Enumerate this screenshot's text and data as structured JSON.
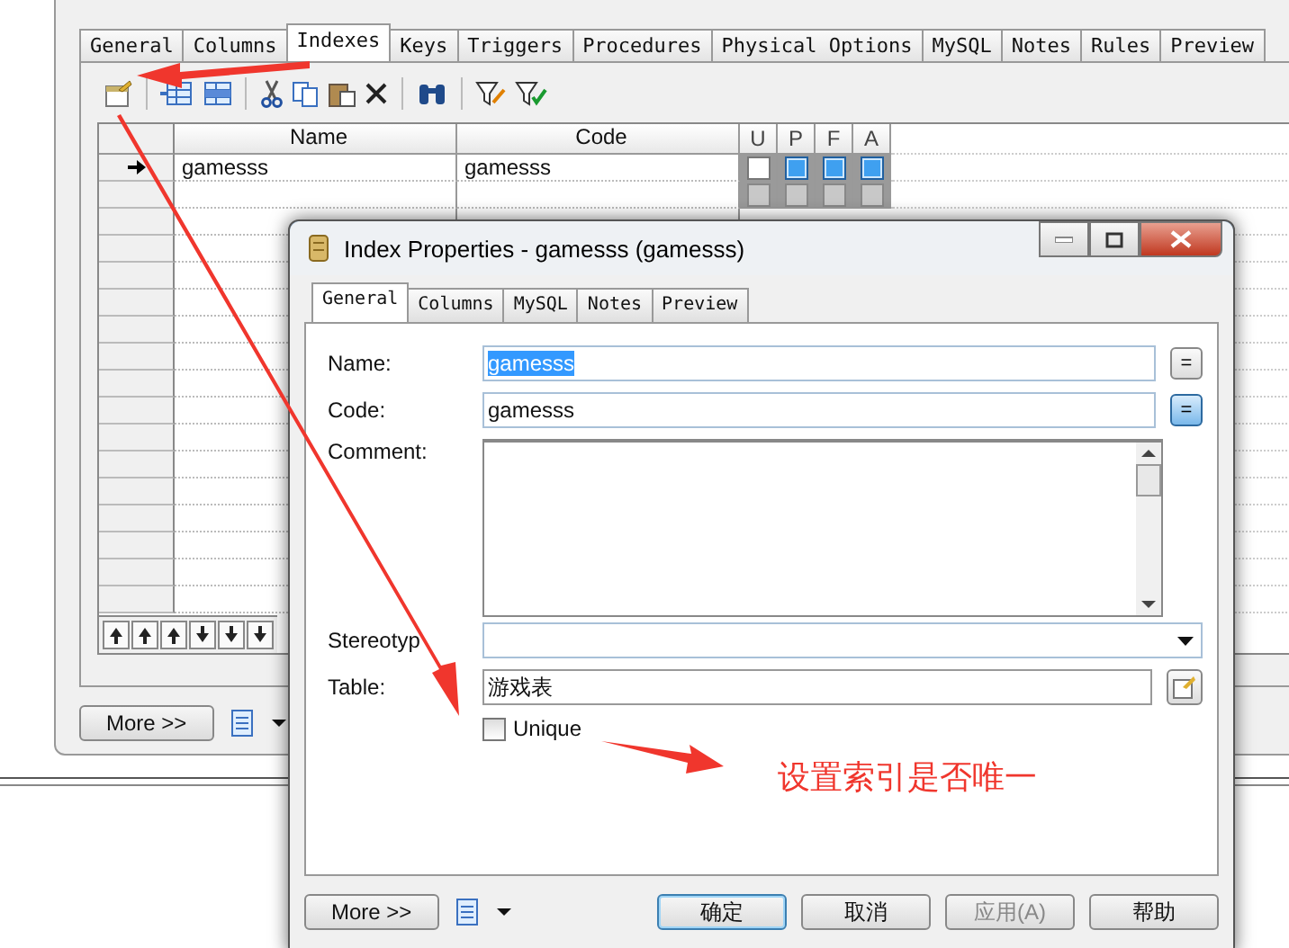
{
  "main_window": {
    "tabs": [
      {
        "label": "General",
        "selected": false
      },
      {
        "label": "Columns",
        "selected": false
      },
      {
        "label": "Indexes",
        "selected": true
      },
      {
        "label": "Keys",
        "selected": false
      },
      {
        "label": "Triggers",
        "selected": false
      },
      {
        "label": "Procedures",
        "selected": false
      },
      {
        "label": "Physical Options",
        "selected": false
      },
      {
        "label": "MySQL",
        "selected": false
      },
      {
        "label": "Notes",
        "selected": false
      },
      {
        "label": "Rules",
        "selected": false
      },
      {
        "label": "Preview",
        "selected": false
      }
    ],
    "grid": {
      "columns": [
        "Name",
        "Code"
      ],
      "flag_columns": [
        "U",
        "P",
        "F",
        "A"
      ],
      "rows": [
        {
          "current": true,
          "disabled": false,
          "name": "gamesss",
          "code": "gamesss",
          "flags": [
            false,
            true,
            true,
            true
          ]
        },
        {
          "current": false,
          "disabled": true,
          "flags": [
            false,
            false,
            false,
            false
          ]
        }
      ]
    },
    "more_button": "More >>"
  },
  "dialog": {
    "title": "Index Properties - gamesss (gamesss)",
    "tabs": [
      {
        "label": "General",
        "selected": true
      },
      {
        "label": "Columns",
        "selected": false
      },
      {
        "label": "MySQL",
        "selected": false
      },
      {
        "label": "Notes",
        "selected": false
      },
      {
        "label": "Preview",
        "selected": false
      }
    ],
    "fields": [
      {
        "kind": "text",
        "label": "Name:",
        "value": "gamesss",
        "selected": true,
        "button": {
          "label": "=",
          "active": false
        }
      },
      {
        "kind": "text",
        "label": "Code:",
        "value": "gamesss",
        "selected": false,
        "button": {
          "label": "=",
          "active": true
        }
      },
      {
        "kind": "textarea",
        "label": "Comment:"
      },
      {
        "kind": "dropdown",
        "label": "Stereotyp"
      },
      {
        "kind": "lookup",
        "label": "Table:",
        "value": "游戏表"
      }
    ],
    "unique": {
      "label": "Unique",
      "checked": false
    },
    "more_button": "More >>",
    "buttons": [
      {
        "label": "确定",
        "default": true,
        "disabled": false
      },
      {
        "label": "取消",
        "default": false,
        "disabled": false
      },
      {
        "label": "应用(A)",
        "default": false,
        "disabled": true
      },
      {
        "label": "帮助",
        "default": false,
        "disabled": false
      }
    ]
  },
  "annotation": "设置索引是否唯一"
}
